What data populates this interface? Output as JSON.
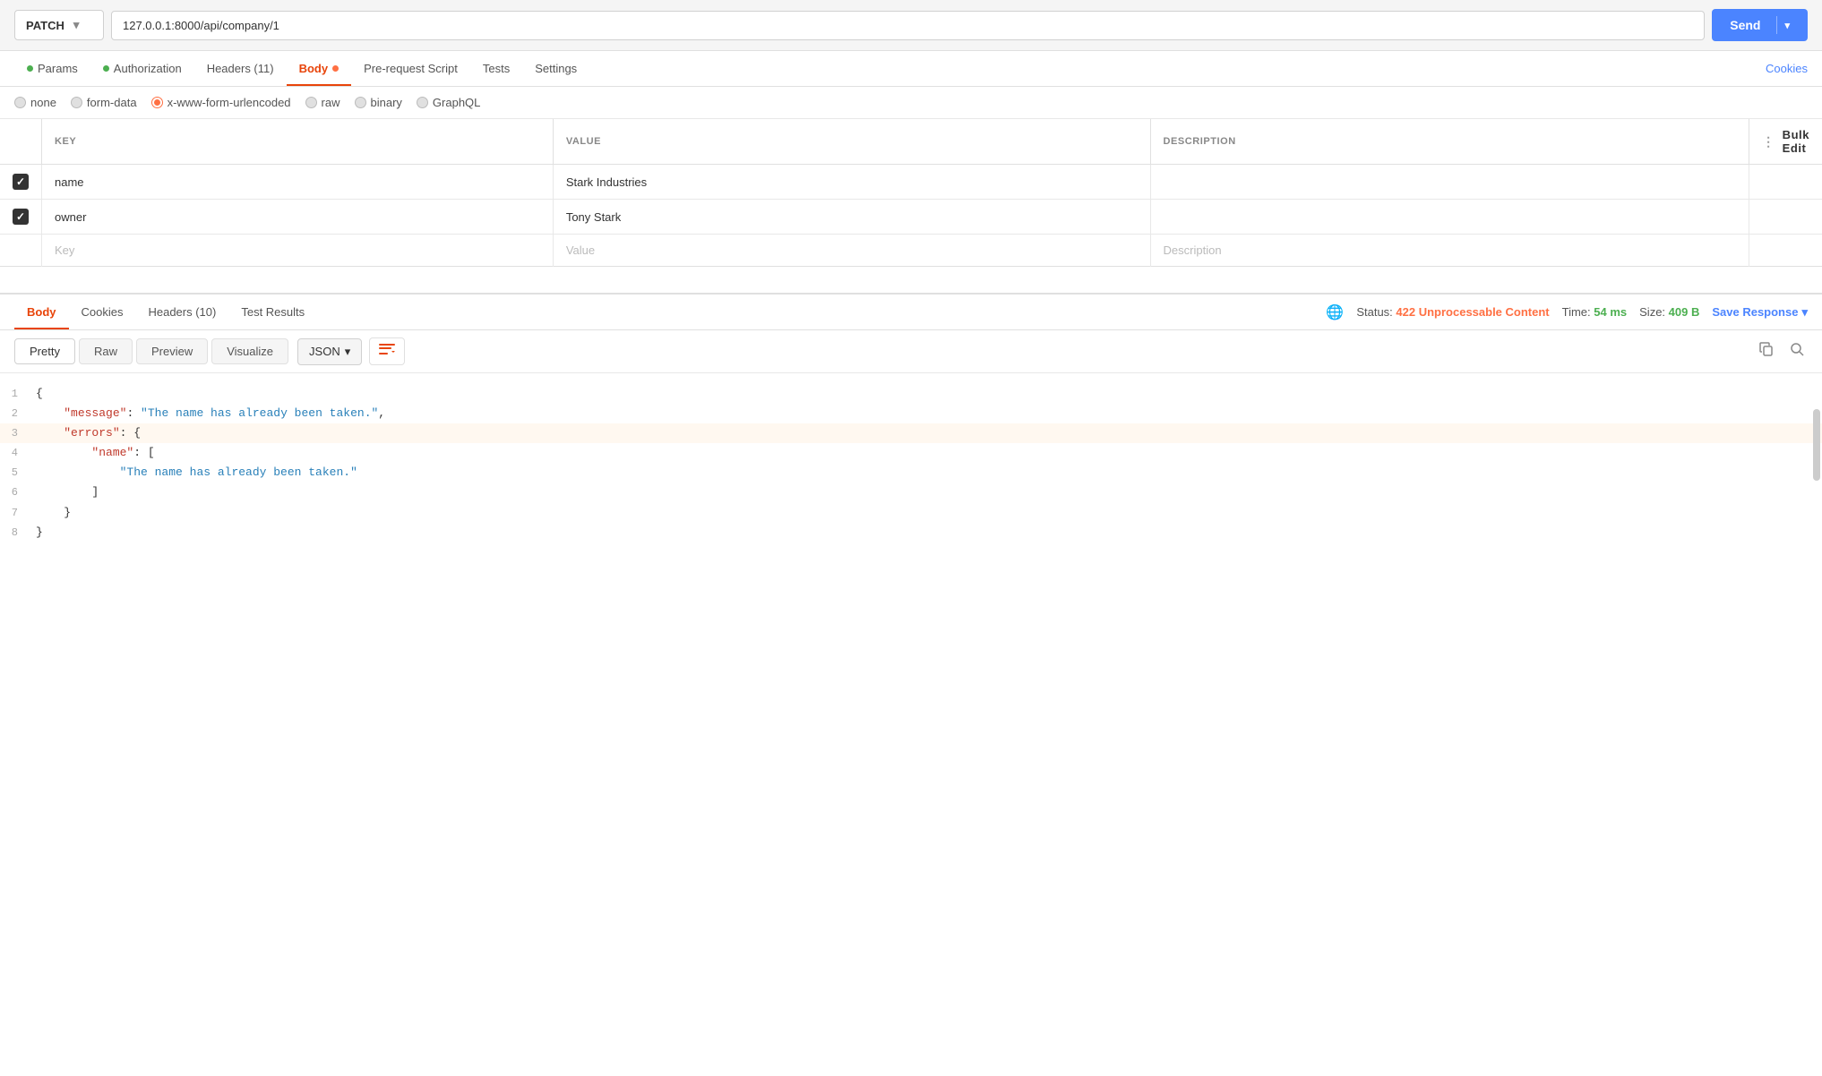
{
  "url_bar": {
    "method": "PATCH",
    "url": "127.0.0.1:8000/api/company/1",
    "send_label": "Send"
  },
  "request_tabs": [
    {
      "id": "params",
      "label": "Params",
      "dot": "green",
      "active": false
    },
    {
      "id": "authorization",
      "label": "Authorization",
      "dot": "green",
      "active": false
    },
    {
      "id": "headers",
      "label": "Headers (11)",
      "dot": null,
      "active": false
    },
    {
      "id": "body",
      "label": "Body",
      "dot": "orange",
      "active": true
    },
    {
      "id": "pre-request",
      "label": "Pre-request Script",
      "dot": null,
      "active": false
    },
    {
      "id": "tests",
      "label": "Tests",
      "dot": null,
      "active": false
    },
    {
      "id": "settings",
      "label": "Settings",
      "dot": null,
      "active": false
    }
  ],
  "cookies_link": "Cookies",
  "body_types": [
    {
      "id": "none",
      "label": "none",
      "state": "inactive"
    },
    {
      "id": "form-data",
      "label": "form-data",
      "state": "inactive"
    },
    {
      "id": "x-www-form-urlencoded",
      "label": "x-www-form-urlencoded",
      "state": "selected"
    },
    {
      "id": "raw",
      "label": "raw",
      "state": "inactive"
    },
    {
      "id": "binary",
      "label": "binary",
      "state": "inactive"
    },
    {
      "id": "graphql",
      "label": "GraphQL",
      "state": "inactive"
    }
  ],
  "table": {
    "headers": [
      "KEY",
      "VALUE",
      "DESCRIPTION"
    ],
    "bulk_edit": "Bulk Edit",
    "rows": [
      {
        "checked": true,
        "key": "name",
        "value": "Stark Industries",
        "description": ""
      },
      {
        "checked": true,
        "key": "owner",
        "value": "Tony Stark",
        "description": ""
      }
    ],
    "placeholder": {
      "key": "Key",
      "value": "Value",
      "description": "Description"
    }
  },
  "response": {
    "tabs": [
      {
        "id": "body",
        "label": "Body",
        "active": true
      },
      {
        "id": "cookies",
        "label": "Cookies",
        "active": false
      },
      {
        "id": "headers",
        "label": "Headers (10)",
        "active": false
      },
      {
        "id": "test-results",
        "label": "Test Results",
        "active": false
      }
    ],
    "status_label": "Status:",
    "status_code": "422 Unprocessable Content",
    "time_label": "Time:",
    "time_val": "54 ms",
    "size_label": "Size:",
    "size_val": "409 B",
    "save_response": "Save Response",
    "view_modes": [
      "Pretty",
      "Raw",
      "Preview",
      "Visualize"
    ],
    "active_view": "Pretty",
    "format": "JSON",
    "code_lines": [
      {
        "num": 1,
        "content": "{"
      },
      {
        "num": 2,
        "content": "    \"message\": \"The name has already been taken.\","
      },
      {
        "num": 3,
        "content": "    \"errors\": {",
        "highlight": true
      },
      {
        "num": 4,
        "content": "        \"name\": ["
      },
      {
        "num": 5,
        "content": "            \"The name has already been taken.\""
      },
      {
        "num": 6,
        "content": "        ]"
      },
      {
        "num": 7,
        "content": "    }"
      },
      {
        "num": 8,
        "content": "}"
      }
    ]
  }
}
